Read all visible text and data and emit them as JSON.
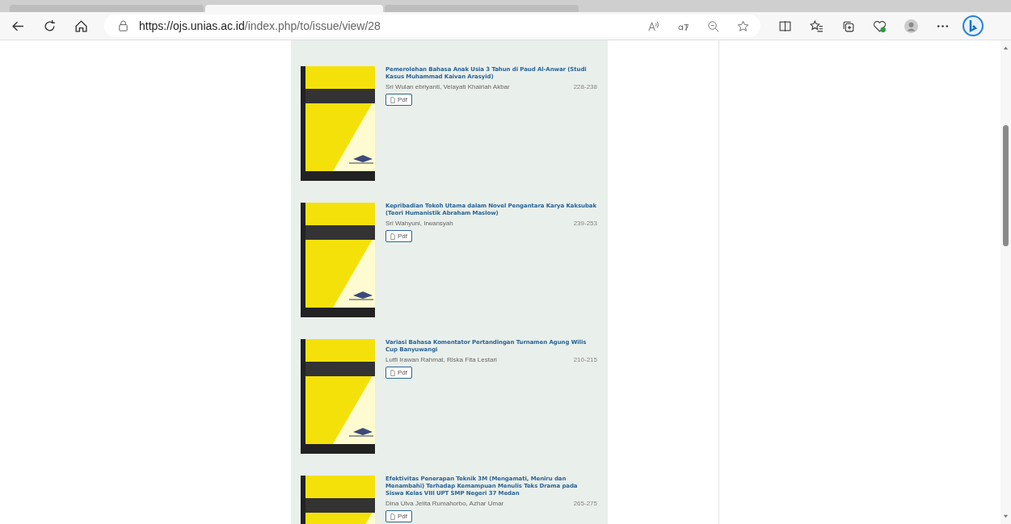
{
  "tabs": [
    {
      "selected": false
    },
    {
      "selected": true
    },
    {
      "selected": false
    }
  ],
  "browser": {
    "url_host": "https://ojs.unias.ac.id",
    "url_path": "/index.php/to/issue/view/28"
  },
  "articles": [
    {
      "title": "Pemerolehan Bahasa Anak Usia 3 Tahun di Paud Al-Anwar (Studi Kasus Muhammad Kaivan Arasyid)",
      "authors": "Sri Wulan ebriyanti, Velayati Khairiah Akbar",
      "pages": "228-238",
      "galley": "Pdf"
    },
    {
      "title": "Kepribadian Tokoh Utama dalam Novel Pengantara Karya Kaksubak (Teori Humanistik Abraham Maslow)",
      "authors": "Sri Wahyuni, Irwansyah",
      "pages": "239-253",
      "galley": "Pdf"
    },
    {
      "title": "Variasi Bahasa Komentator Pertandingan Turnamen Agung Wilis Cup Banyuwangi",
      "authors": "Lutfi Irawan Rahmat, Riska Fita Lestari",
      "pages": "210-215",
      "galley": "Pdf"
    },
    {
      "title": "Efektivitas Penerapan Teknik 3M (Mengamati, Meniru dan Menambahi) Terhadap Kemampuan Menulis Teks Drama pada Siswa Kelas VIII UPT SMP Negeri 37 Medan",
      "authors": "Dina Ulva Jelita Rumahorbo, Azhar Umar",
      "pages": "265-275",
      "galley": "Pdf"
    }
  ]
}
